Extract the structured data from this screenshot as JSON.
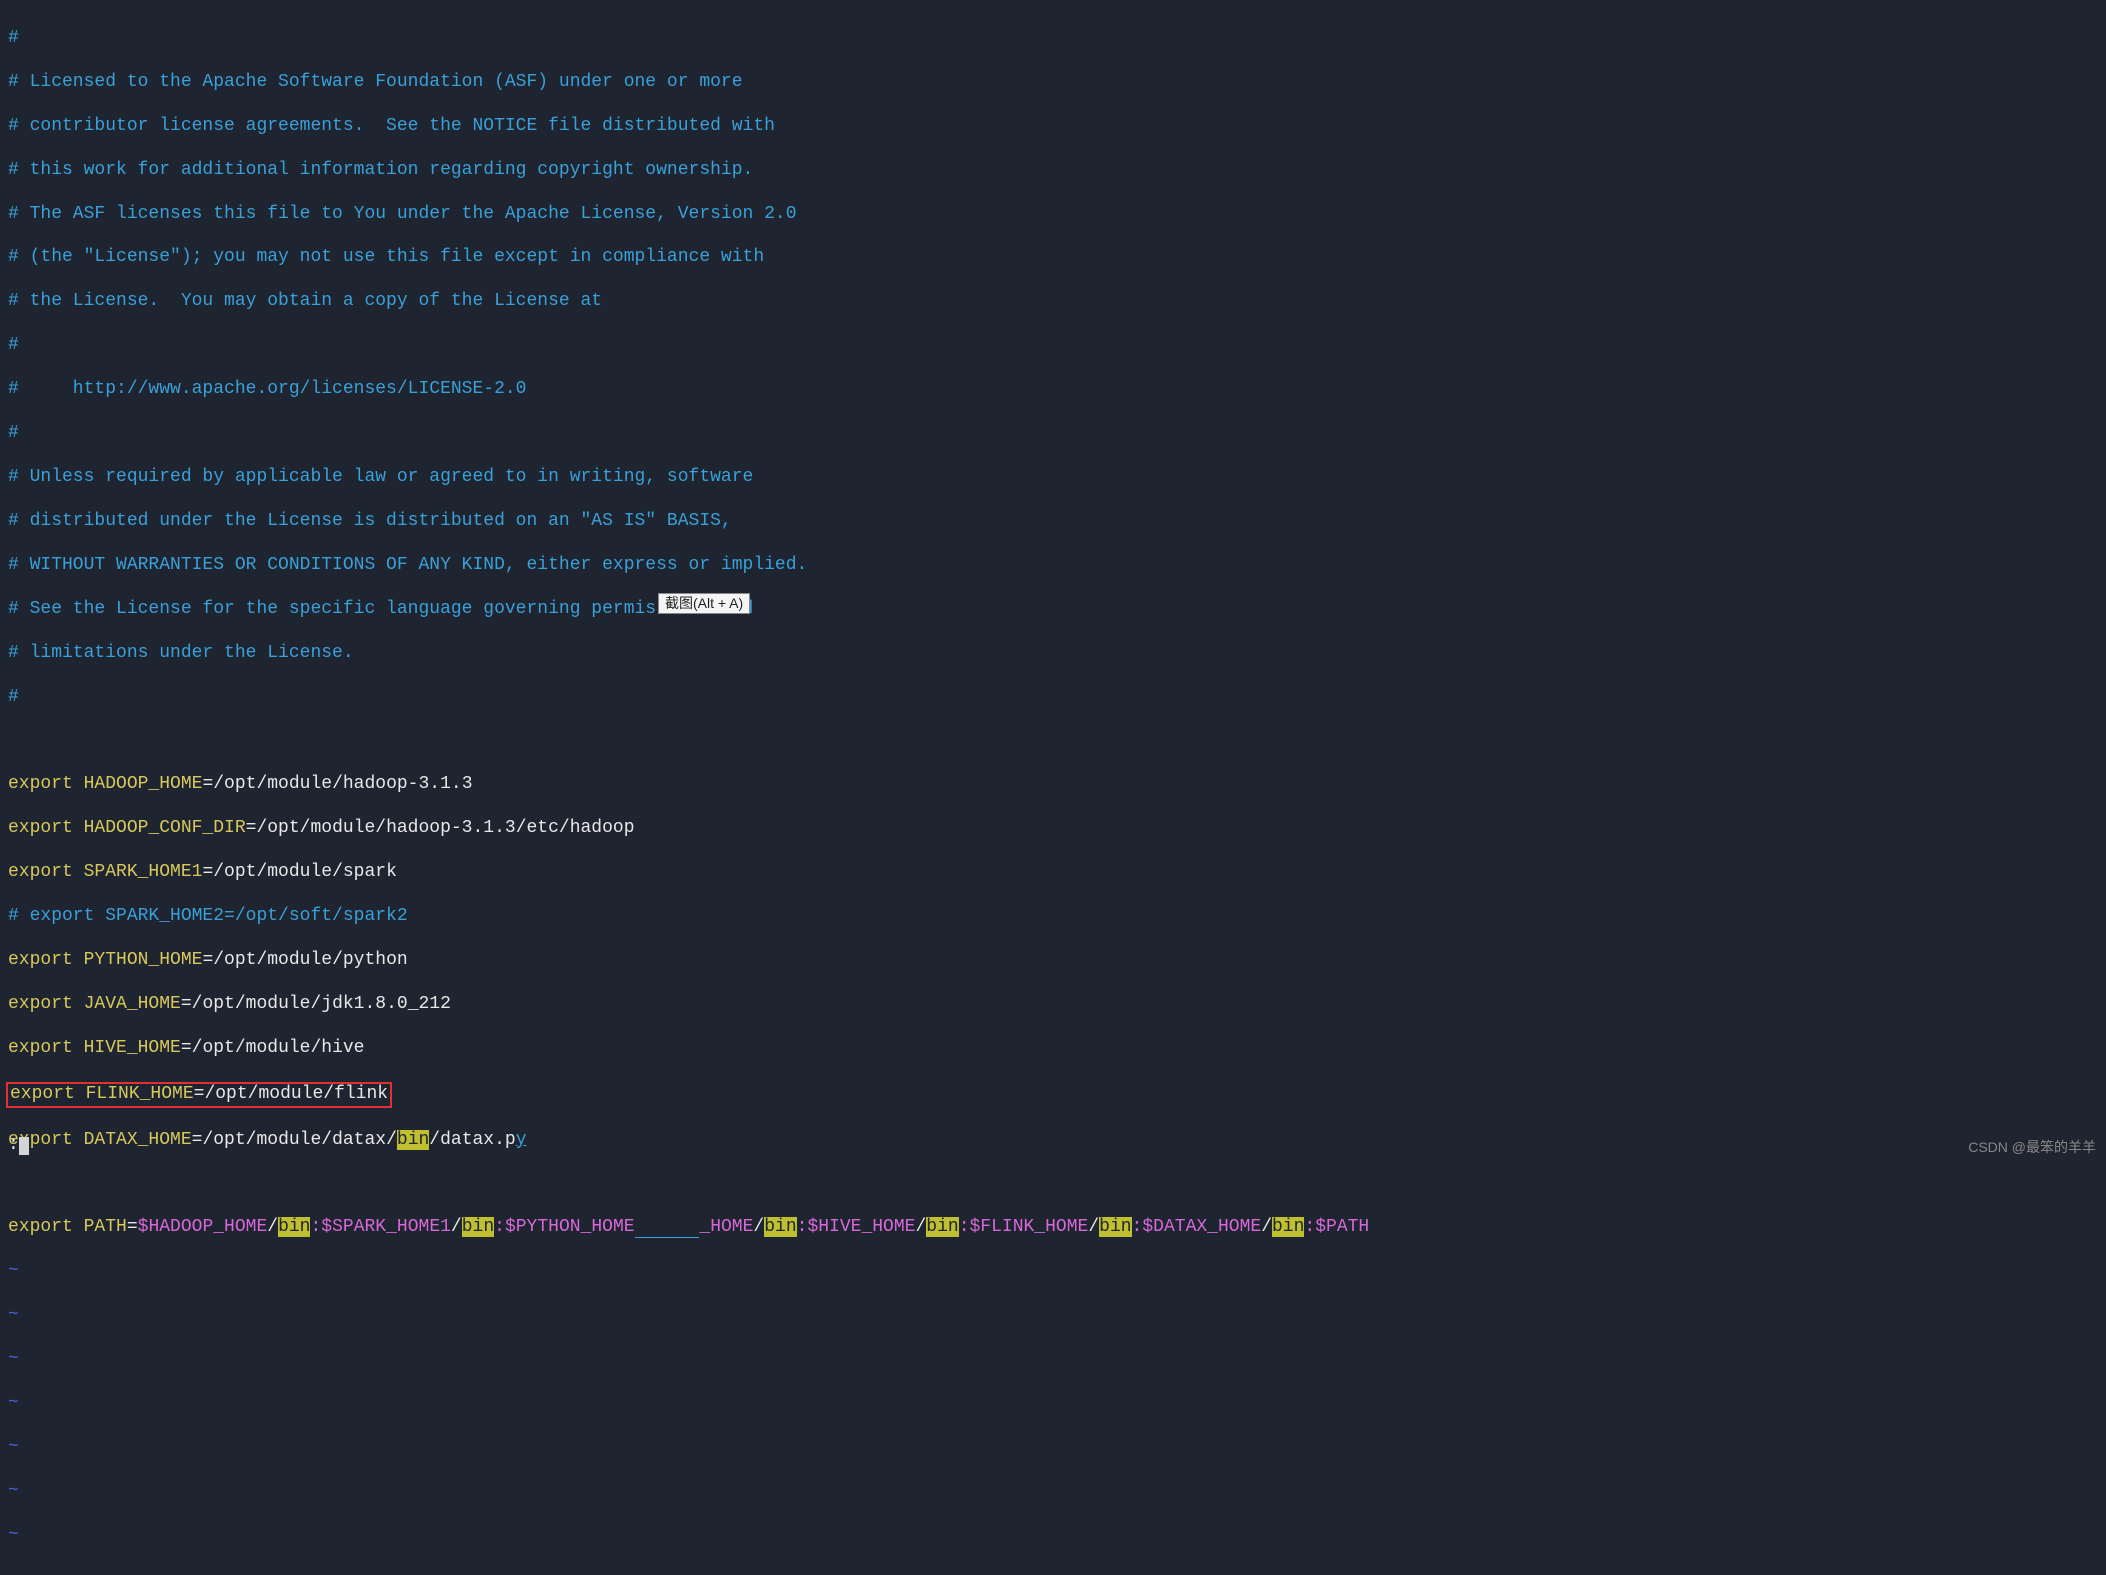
{
  "license": {
    "l1": "#",
    "l2": "# Licensed to the Apache Software Foundation (ASF) under one or more",
    "l3": "# contributor license agreements.  See the NOTICE file distributed with",
    "l4": "# this work for additional information regarding copyright ownership.",
    "l5": "# The ASF licenses this file to You under the Apache License, Version 2.0",
    "l6": "# (the \"License\"); you may not use this file except in compliance with",
    "l7": "# the License.  You may obtain a copy of the License at",
    "l8": "#",
    "l9": "#     http://www.apache.org/licenses/LICENSE-2.0",
    "l10": "#",
    "l11": "# Unless required by applicable law or agreed to in writing, software",
    "l12": "# distributed under the License is distributed on an \"AS IS\" BASIS,",
    "l13": "# WITHOUT WARRANTIES OR CONDITIONS OF ANY KIND, either express or implied.",
    "l14": "# See the License for the specific language governing permissions and",
    "l15": "# limitations under the License.",
    "l16": "#"
  },
  "exports": {
    "kw": "export",
    "eq": "=",
    "hadoop_home_var": " HADOOP_HOME",
    "hadoop_home_val": "/opt/module/hadoop-3.1.3",
    "hadoop_conf_var": " HADOOP_CONF_DIR",
    "hadoop_conf_val": "/opt/module/hadoop-3.1.3/etc/hadoop",
    "spark1_var": " SPARK_HOME1",
    "spark1_val": "/opt/module/spark",
    "spark2_comment": "# export SPARK_HOME2=/opt/soft/spark2",
    "python_var": " PYTHON_HOME",
    "python_val": "/opt/module/python",
    "java_var": " JAVA_HOME",
    "java_val": "/opt/module/jdk1.8.0_212",
    "hive_var": " HIVE_HOME",
    "hive_val": "/opt/module/hive",
    "flink_var": " FLINK_HOME",
    "flink_val": "/opt/module/flink",
    "datax_var": " DATAX_HOME",
    "datax_val1": "/opt/module/datax/",
    "datax_bin": "bin",
    "datax_val2": "/datax.p",
    "datax_y": "y"
  },
  "path_line": {
    "kw": "export",
    "var": " PATH",
    "eq": "=",
    "p1": "$HADOOP_HOME",
    "slash": "/",
    "bin": "bin",
    "colon": ":",
    "p2": "$SPARK_HOME1",
    "p3": "$PYTHON_HOME",
    "mid_hidden": "      ",
    "p4": "_HOME",
    "p5": "$HIVE_HOME",
    "p6": "$FLINK_HOME",
    "p7": "$DATAX_HOME",
    "p8": "$PATH"
  },
  "tooltip": "截图(Alt + A)",
  "tilde": "~",
  "cmd": ":",
  "watermark": "CSDN @最笨的羊羊"
}
